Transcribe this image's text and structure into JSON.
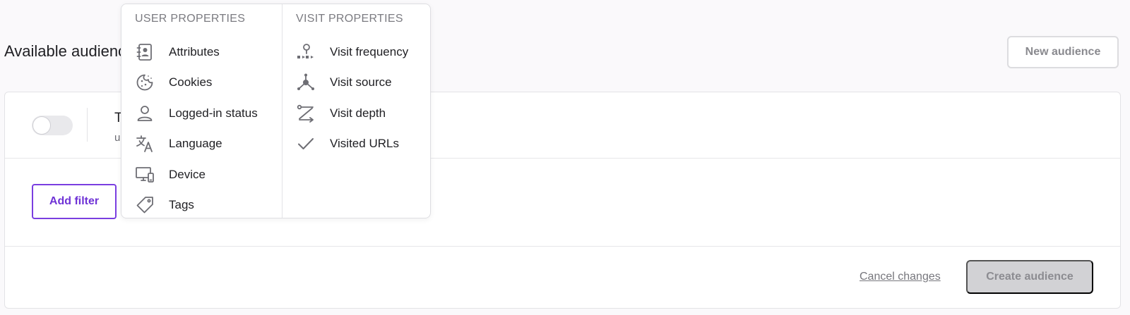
{
  "page": {
    "title": "Available audiences",
    "new_audience_label": "New audience"
  },
  "audience_card": {
    "name": "T",
    "description": "u",
    "toggle_on": false,
    "add_filter_label": "Add filter",
    "cancel_label": "Cancel changes",
    "create_label": "Create audience"
  },
  "menu": {
    "user_heading": "USER PROPERTIES",
    "visit_heading": "VISIT PROPERTIES",
    "user_items": [
      {
        "label": "Attributes",
        "icon": "contact-book-icon"
      },
      {
        "label": "Cookies",
        "icon": "cookie-icon"
      },
      {
        "label": "Logged-in status",
        "icon": "person-icon"
      },
      {
        "label": "Language",
        "icon": "translate-icon"
      },
      {
        "label": "Device",
        "icon": "devices-icon"
      },
      {
        "label": "Tags",
        "icon": "tag-icon"
      }
    ],
    "visit_items": [
      {
        "label": "Visit frequency",
        "icon": "visit-frequency-icon"
      },
      {
        "label": "Visit source",
        "icon": "visit-source-icon"
      },
      {
        "label": "Visit depth",
        "icon": "visit-depth-icon"
      },
      {
        "label": "Visited URLs",
        "icon": "checkmark-icon"
      }
    ]
  },
  "colors": {
    "accent": "#7a3ee0",
    "icon": "#6e6e74",
    "disabled_button": "#d2d2d5"
  }
}
